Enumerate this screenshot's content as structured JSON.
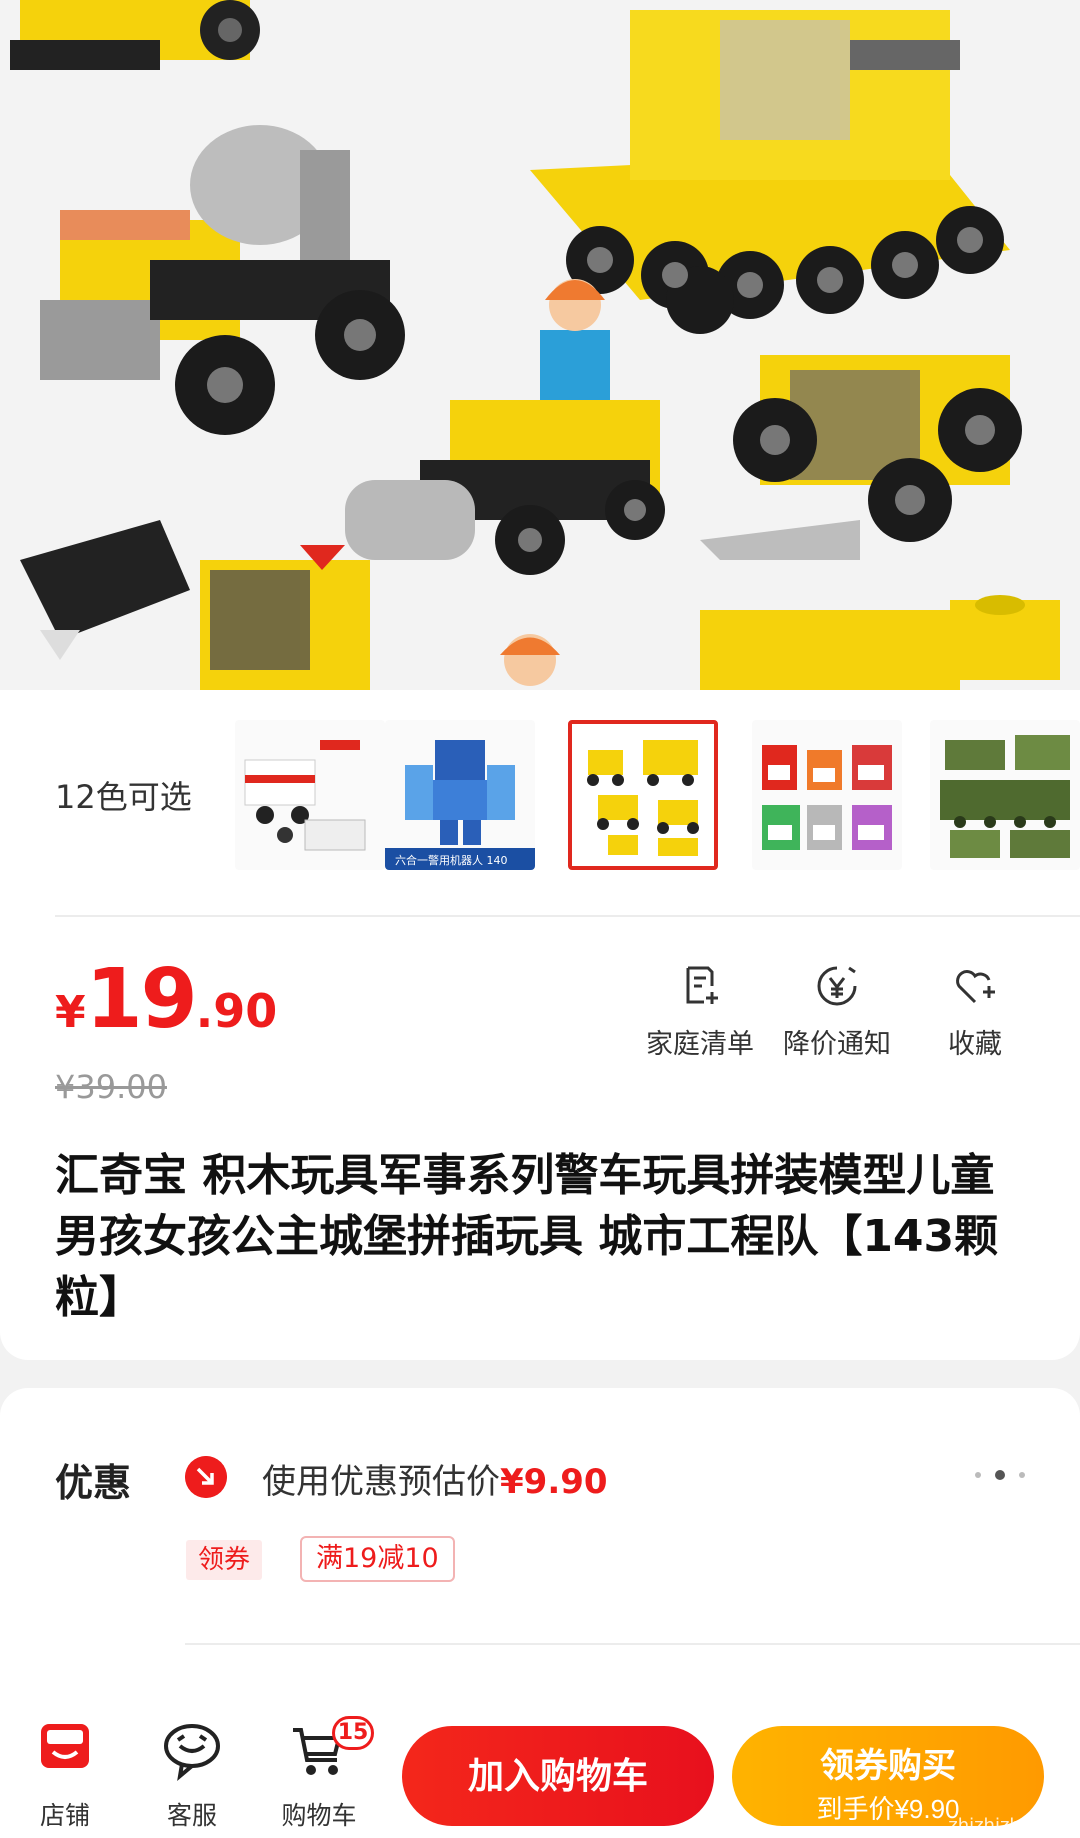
{
  "colors": {
    "accent": "#ee1c1c",
    "orange": "#ffa200",
    "lego_yellow": "#f5d20c",
    "text": "#222222"
  },
  "variants": {
    "label": "12色可选",
    "selected_index": 2,
    "thumbs": [
      "ambulance-set",
      "robot-set",
      "construction-set",
      "shop-set",
      "military-set"
    ],
    "thumb_caption": "六合一警用机器人 140"
  },
  "price": {
    "symbol": "¥",
    "integer": "19",
    "decimal": ".90",
    "original": "¥39.00"
  },
  "actions": [
    {
      "label": "家庭清单",
      "icon": "list-add-icon"
    },
    {
      "label": "降价通知",
      "icon": "yen-alert-icon"
    },
    {
      "label": "收藏",
      "icon": "heart-plus-icon"
    }
  ],
  "product": {
    "title": "汇奇宝 积木玩具军事系列警车玩具拼装模型儿童男孩女孩公主城堡拼插玩具 城市工程队【143颗粒】"
  },
  "promo": {
    "title": "优惠",
    "text": "使用优惠预估价",
    "price": "¥9.90",
    "coupon_tag": "领券",
    "deal_tag": "满19减10"
  },
  "bottom_bar": {
    "shop": "店铺",
    "service": "客服",
    "cart": "购物车",
    "cart_count": "15",
    "add_to_cart": "加入购物车",
    "buy_line1": "领券购买",
    "buy_line2": "到手价¥9.90"
  },
  "watermark": {
    "text": "zhizhizhi.com"
  }
}
